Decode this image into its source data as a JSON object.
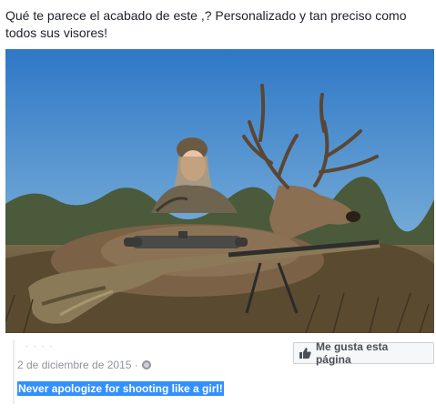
{
  "post": {
    "caption": "Qué te parece el acabado de este           ,? Personalizado y tan preciso como todos sus visores!"
  },
  "embed": {
    "page_name": "· · · ·",
    "date": "2 de diciembre de 2015 ·",
    "privacy_icon": "globe-icon",
    "like_button_label": "Me gusta esta página",
    "like_icon": "thumbs-up-icon",
    "quote": "Never apologize for shooting like a girl!"
  },
  "colors": {
    "text": "#1d2129",
    "meta": "#90949c",
    "selection": "#3390ff",
    "button_bg": "#f6f7f9",
    "button_border": "#ced0d4"
  }
}
